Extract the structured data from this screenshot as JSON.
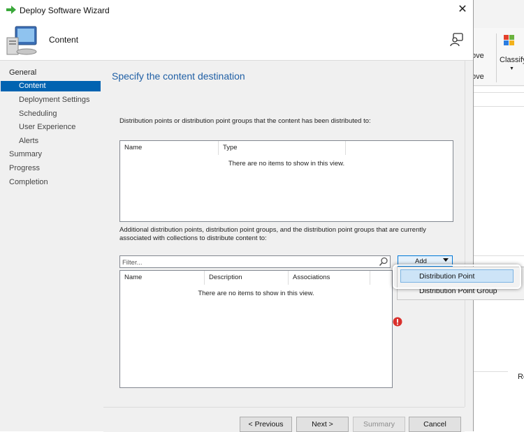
{
  "window": {
    "title": "Deploy Software Wizard",
    "close_glyph": "✕"
  },
  "header": {
    "title": "Content"
  },
  "nav": {
    "items": [
      {
        "label": "General",
        "level": 0
      },
      {
        "label": "Content",
        "level": 1,
        "selected": true
      },
      {
        "label": "Deployment Settings",
        "level": 1
      },
      {
        "label": "Scheduling",
        "level": 1
      },
      {
        "label": "User Experience",
        "level": 1
      },
      {
        "label": "Alerts",
        "level": 1
      },
      {
        "label": "Summary",
        "level": 0
      },
      {
        "label": "Progress",
        "level": 0
      },
      {
        "label": "Completion",
        "level": 0
      }
    ]
  },
  "content": {
    "title": "Specify the content destination",
    "distributed_desc": "Distribution points or distribution point groups that the content has been distributed to:",
    "distributed_list": {
      "columns": [
        "Name",
        "Type"
      ],
      "empty_text": "There are no items to show in this view."
    },
    "additional_desc": "Additional distribution points, distribution point groups, and the distribution point groups that are currently associated with collections to distribute content to:",
    "filter": {
      "placeholder": "Filter...",
      "value": ""
    },
    "add_button": "Add",
    "additional_list": {
      "columns": [
        "Name",
        "Description",
        "Associations"
      ],
      "empty_text": "There are no items to show in this view."
    }
  },
  "add_menu": {
    "items": [
      "Distribution Point",
      "Distribution Point Group"
    ]
  },
  "footer": {
    "previous": "< Previous",
    "next": "Next >",
    "summary": "Summary",
    "cancel": "Cancel"
  },
  "background_app": {
    "ribbon_text_1": "ove",
    "ribbon_text_2": "ove",
    "classify": "Classify",
    "r_label": "Re"
  },
  "colors": {
    "accent": "#0063b1",
    "title_blue": "#1f5fa5",
    "error_red": "#d9302c"
  }
}
